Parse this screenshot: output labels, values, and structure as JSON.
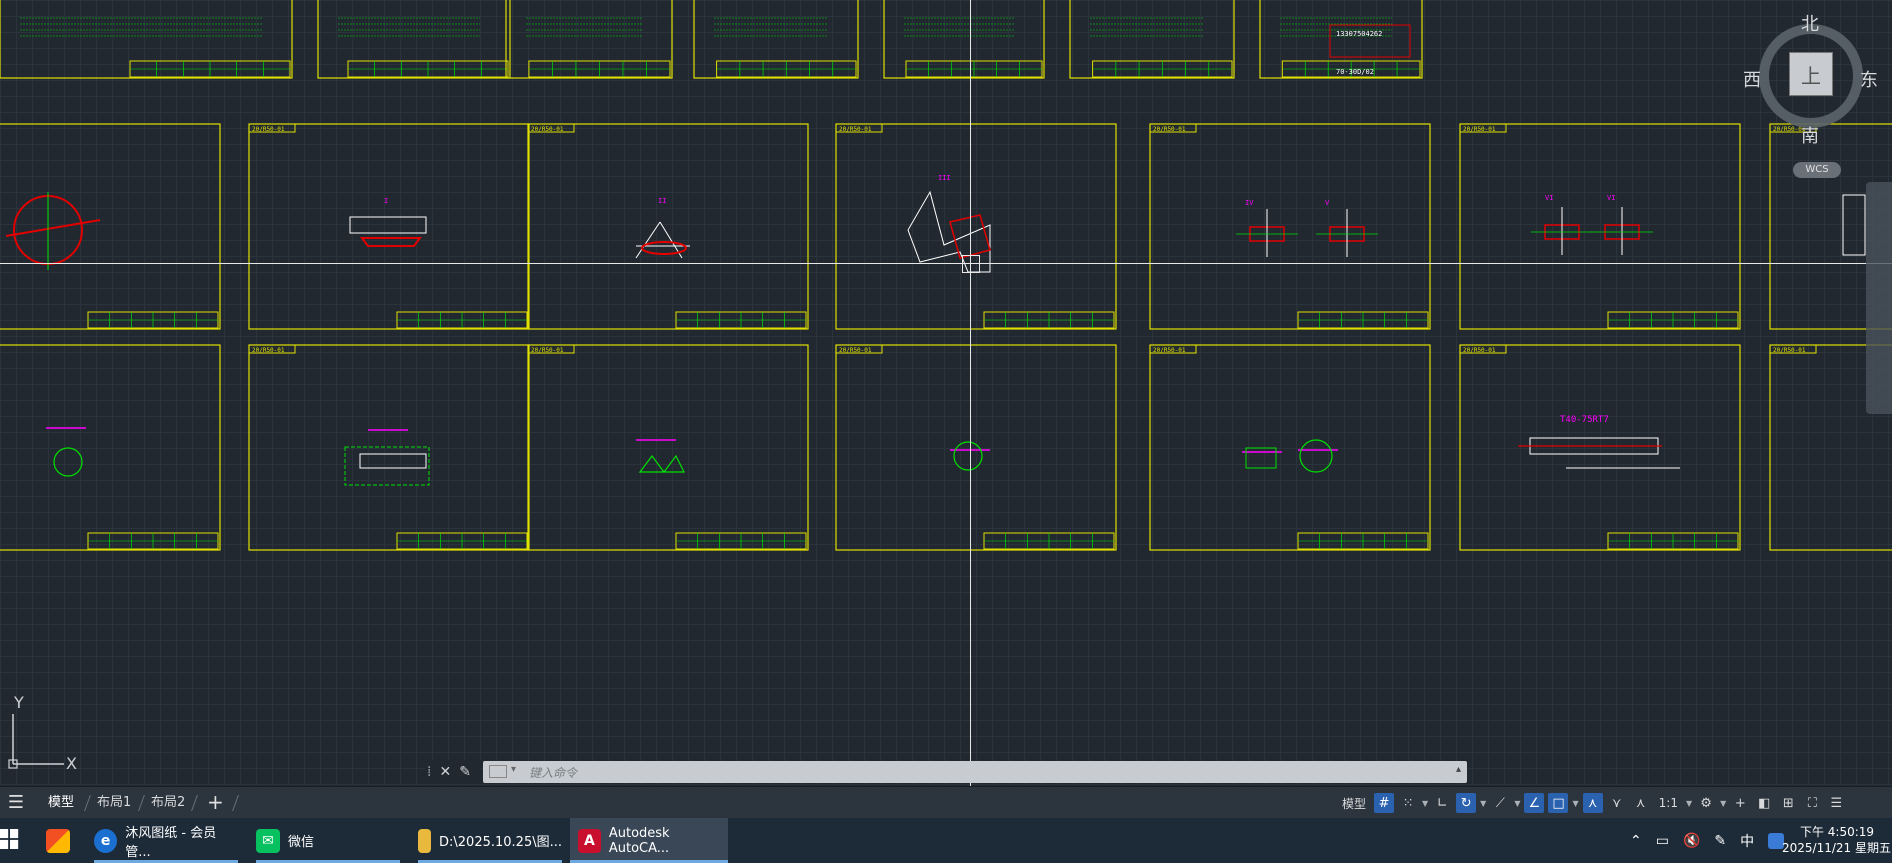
{
  "window": {
    "app": "Autodesk AutoCAD"
  },
  "viewcube": {
    "north": "北",
    "south": "南",
    "east": "东",
    "west": "西",
    "top_face": "上",
    "wcs_label": "WCS"
  },
  "ucs": {
    "x_label": "X",
    "y_label": "Y"
  },
  "drawing": {
    "sheet_tag": "20/R50-01",
    "detail_labels": [
      "I",
      "II",
      "III",
      "IV",
      "V",
      "VI",
      "T40-75RT7"
    ],
    "title_block": {
      "phone": "13307504262",
      "code": "70-30D/02"
    },
    "colors": {
      "border": "#e1e100",
      "green": "#00e100",
      "red": "#e10000",
      "magenta": "#ff00ff",
      "white": "#ffffff"
    }
  },
  "command_line": {
    "placeholder": "键入命令"
  },
  "layout_tabs": [
    "模型",
    "布局1",
    "布局2"
  ],
  "status_bar": {
    "model_label": "模型",
    "scale": "1:1"
  },
  "taskbar": {
    "items": [
      {
        "label": "沐风图纸 - 会员管...",
        "icon": "edge-icon"
      },
      {
        "label": "微信",
        "icon": "wechat-icon"
      },
      {
        "label": "D:\\2025.10.25\\图...",
        "icon": "folder-icon"
      },
      {
        "label": "Autodesk AutoCA...",
        "icon": "autocad-icon"
      }
    ],
    "tray": {
      "ime": "中",
      "time": "下午 4:50:19",
      "date": "2025/11/21 星期五"
    }
  }
}
